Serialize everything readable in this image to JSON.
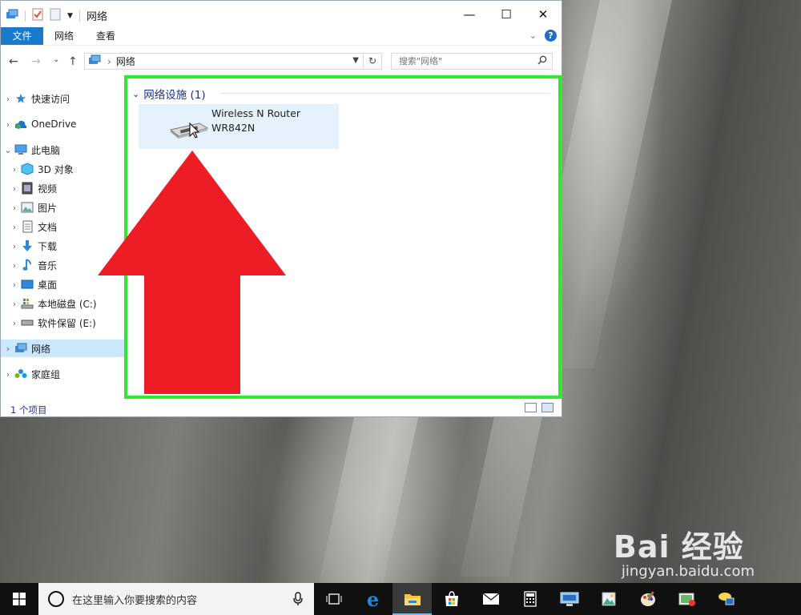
{
  "window": {
    "title": "网络",
    "controls": {
      "minimize": "—",
      "maximize": "☐",
      "close": "✕"
    }
  },
  "ribbon": {
    "file_tab": "文件",
    "tabs": [
      "网络",
      "查看"
    ],
    "help": "?"
  },
  "navigation": {
    "back": "←",
    "forward": "→",
    "recent": "⌄",
    "up": "↑",
    "address_path": "网络",
    "address_separator": "›",
    "refresh": "↻",
    "search_placeholder": "搜索\"网络\""
  },
  "sidebar": {
    "items": [
      {
        "label": "快速访问",
        "icon": "quick-access-star-icon"
      },
      {
        "label": "OneDrive",
        "icon": "onedrive-cloud-icon"
      },
      {
        "label": "此电脑",
        "icon": "this-pc-icon"
      },
      {
        "label": "3D 对象",
        "icon": "3d-objects-icon"
      },
      {
        "label": "视频",
        "icon": "video-icon"
      },
      {
        "label": "图片",
        "icon": "pictures-icon"
      },
      {
        "label": "文档",
        "icon": "documents-icon"
      },
      {
        "label": "下载",
        "icon": "downloads-icon"
      },
      {
        "label": "音乐",
        "icon": "music-icon"
      },
      {
        "label": "桌面",
        "icon": "desktop-icon"
      },
      {
        "label": "本地磁盘 (C:)",
        "icon": "local-disk-icon"
      },
      {
        "label": "软件保留 (E:)",
        "icon": "drive-icon"
      },
      {
        "label": "网络",
        "icon": "network-icon",
        "selected": true
      },
      {
        "label": "家庭组",
        "icon": "homegroup-icon"
      }
    ]
  },
  "content": {
    "group_header": "网络设施 (1)",
    "device": {
      "name_line1": "Wireless N Router",
      "name_line2": "WR842N"
    }
  },
  "status": {
    "item_count": "1 个项目"
  },
  "taskbar": {
    "search_placeholder": "在这里输入你要搜索的内容",
    "icons": [
      "task-view-icon",
      "edge-icon",
      "file-explorer-icon",
      "store-icon",
      "mail-icon",
      "calculator-icon",
      "remote-desktop-icon",
      "pictures-app-icon",
      "paint-icon",
      "photo-app-icon",
      "network-app-icon"
    ]
  },
  "watermark": {
    "brand": "Bai 经验",
    "site": "jingyan.baidu.com"
  },
  "colors": {
    "highlight_box": "#31e82f",
    "arrow": "#ee1c24",
    "file_tab": "#1979ca",
    "selection": "#cce8ff"
  }
}
